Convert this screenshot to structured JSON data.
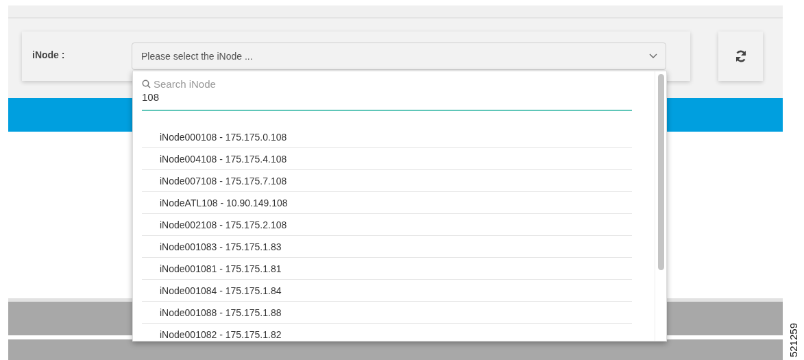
{
  "selector": {
    "label": "iNode :",
    "placeholder": "Please select the iNode ..."
  },
  "dropdown": {
    "search_placeholder": "Search iNode",
    "search_value": "108",
    "options": [
      {
        "label": "iNode000108 - 175.175.0.108"
      },
      {
        "label": "iNode004108 - 175.175.4.108"
      },
      {
        "label": "iNode007108 - 175.175.7.108"
      },
      {
        "label": "iNodeATL108 - 10.90.149.108"
      },
      {
        "label": "iNode002108 - 175.175.2.108"
      },
      {
        "label": "iNode001083 - 175.175.1.83"
      },
      {
        "label": "iNode001081 - 175.175.1.81"
      },
      {
        "label": "iNode001084 - 175.175.1.84"
      },
      {
        "label": "iNode001088 - 175.175.1.88"
      },
      {
        "label": "iNode001082 - 175.175.1.82"
      }
    ]
  },
  "figure_number": "521259"
}
